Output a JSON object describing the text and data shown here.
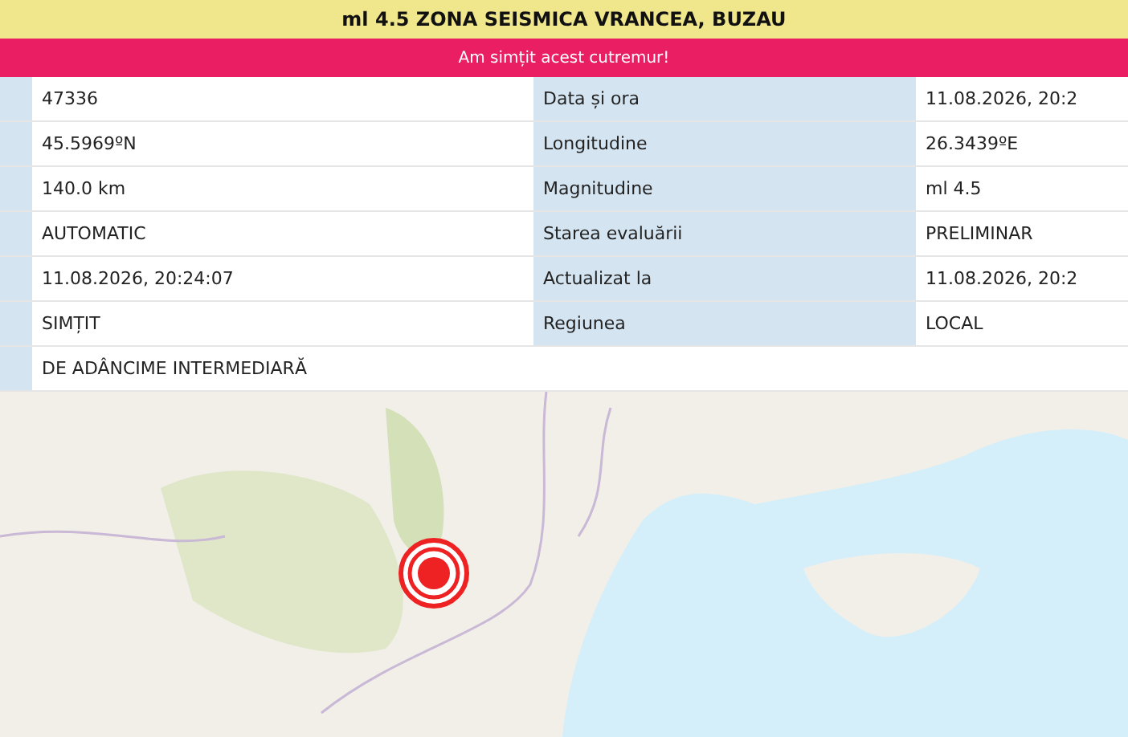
{
  "title": "ml 4.5 ZONA SEISMICA VRANCEA, BUZAU",
  "felt_button": "Am simțit acest cutremur!",
  "rows": [
    {
      "value": "47336",
      "label": "Data și ora",
      "label_value": "11.08.2026, 20:2"
    },
    {
      "value": "45.5969ºN",
      "label": "Longitudine",
      "label_value": "26.3439ºE"
    },
    {
      "value": "140.0 km",
      "label": "Magnitudine",
      "label_value": "ml 4.5"
    },
    {
      "value": "AUTOMATIC",
      "label": "Starea evaluării",
      "label_value": "PRELIMINAR"
    },
    {
      "value": "11.08.2026, 20:24:07",
      "label": "Actualizat la",
      "label_value": "11.08.2026, 20:2"
    },
    {
      "value": "SIMȚIT",
      "label": "Regiunea",
      "label_value": "LOCAL"
    },
    {
      "value": "DE ADÂNCIME INTERMEDIARĂ"
    }
  ]
}
